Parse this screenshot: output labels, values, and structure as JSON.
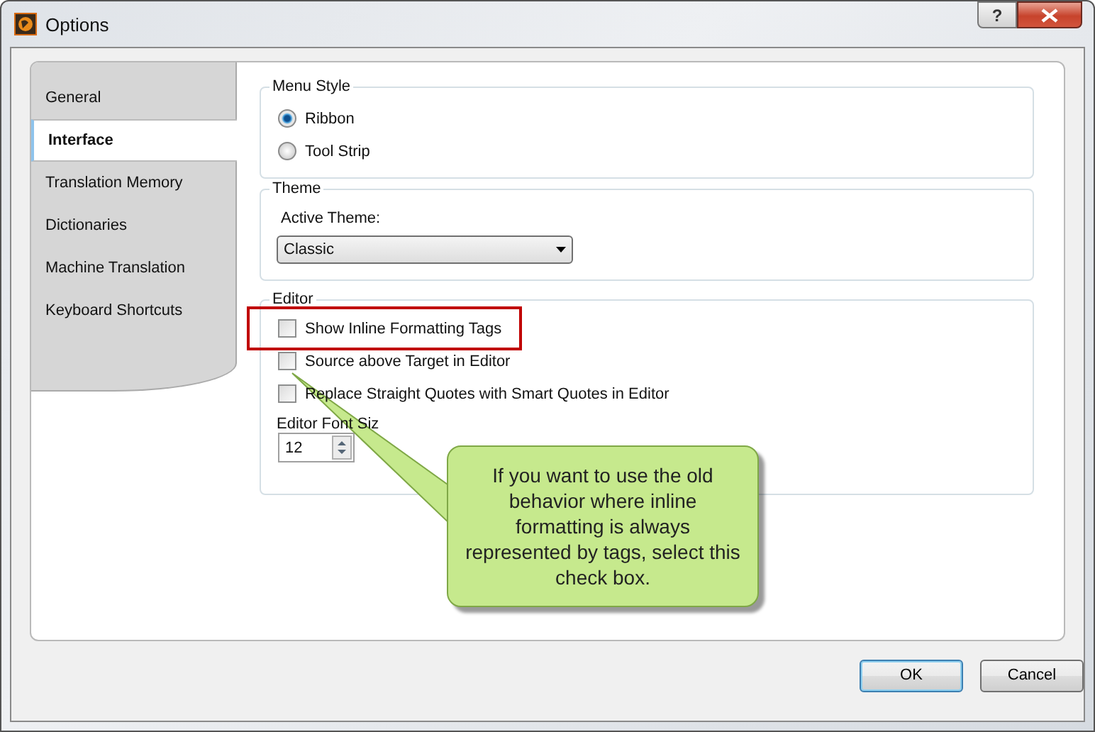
{
  "window": {
    "title": "Options",
    "help": "?"
  },
  "sidebar": {
    "items": [
      {
        "label": "General",
        "selected": false
      },
      {
        "label": "Interface",
        "selected": true
      },
      {
        "label": "Translation Memory",
        "selected": false
      },
      {
        "label": "Dictionaries",
        "selected": false
      },
      {
        "label": "Machine Translation",
        "selected": false
      },
      {
        "label": "Keyboard Shortcuts",
        "selected": false
      }
    ]
  },
  "menu_style": {
    "title": "Menu Style",
    "options": [
      {
        "label": "Ribbon",
        "selected": true
      },
      {
        "label": "Tool Strip",
        "selected": false
      }
    ]
  },
  "theme": {
    "title": "Theme",
    "label": "Active Theme:",
    "value": "Classic"
  },
  "editor": {
    "title": "Editor",
    "checkboxes": [
      {
        "label": "Show Inline Formatting Tags",
        "checked": false,
        "highlighted": true
      },
      {
        "label": "Source above Target in Editor",
        "checked": false,
        "highlighted": false
      },
      {
        "label": "Replace Straight Quotes with Smart Quotes in Editor",
        "checked": false,
        "highlighted": false
      }
    ],
    "font_size_label": "Editor Font Siz",
    "font_size": "12"
  },
  "callout": {
    "text": "If you want to use the old behavior where inline formatting is always represented by tags, select this check box."
  },
  "buttons": [
    {
      "label": "OK",
      "default": true
    },
    {
      "label": "Cancel",
      "default": false
    }
  ]
}
